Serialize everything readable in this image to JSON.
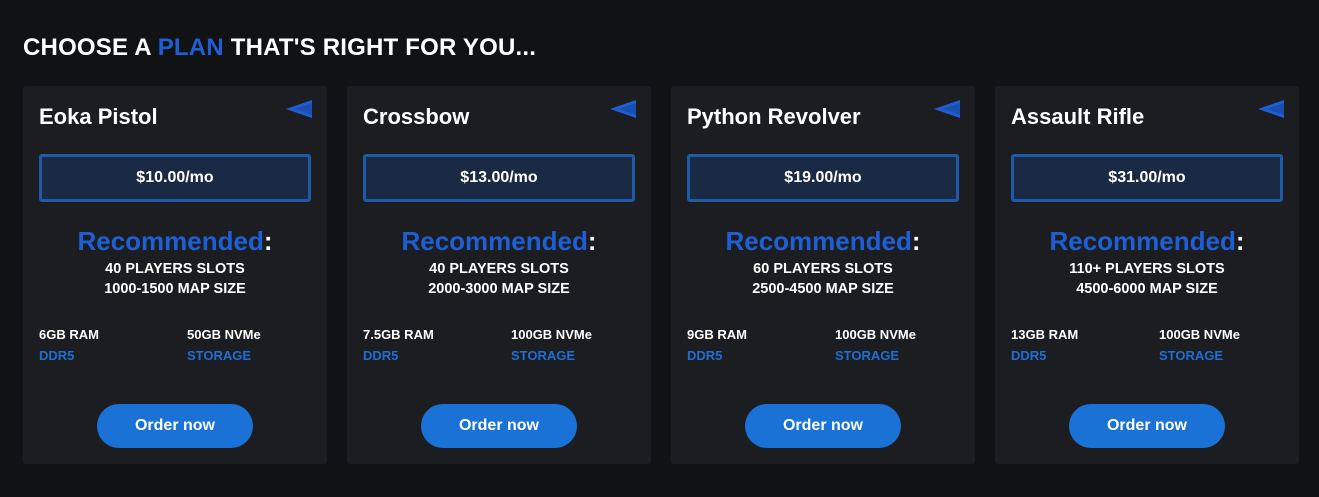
{
  "heading": {
    "prefix": "CHOOSE A ",
    "accent": "PLAN",
    "suffix": " THAT'S RIGHT FOR YOU..."
  },
  "colors": {
    "background": "#111214",
    "card": "#1c1d20",
    "accent": "#1f5fd6",
    "button": "#1a72d6",
    "price_border": "#1e5aa8",
    "price_fill": "#1a2a44"
  },
  "plans": [
    {
      "name": "Eoka Pistol",
      "icon": "arrow-left-icon",
      "price": "$10.00/mo",
      "recommended_label": "Recommended",
      "recommended_colon": ":",
      "players": "40 PLAYERS SLOTS",
      "map_size": "1000-1500 MAP SIZE",
      "ram": "6GB RAM",
      "ram_sub": "DDR5",
      "storage": "50GB NVMe",
      "storage_sub": "STORAGE",
      "button": "Order now"
    },
    {
      "name": "Crossbow",
      "icon": "arrow-left-icon",
      "price": "$13.00/mo",
      "recommended_label": "Recommended",
      "recommended_colon": ":",
      "players": "40 PLAYERS SLOTS",
      "map_size": "2000-3000 MAP SIZE",
      "ram": "7.5GB RAM",
      "ram_sub": "DDR5",
      "storage": "100GB NVMe",
      "storage_sub": "STORAGE",
      "button": "Order now"
    },
    {
      "name": "Python Revolver",
      "icon": "arrow-left-icon",
      "price": "$19.00/mo",
      "recommended_label": "Recommended",
      "recommended_colon": ":",
      "players": "60 PLAYERS SLOTS",
      "map_size": "2500-4500 MAP SIZE",
      "ram": "9GB RAM",
      "ram_sub": "DDR5",
      "storage": "100GB NVMe",
      "storage_sub": "STORAGE",
      "button": "Order now"
    },
    {
      "name": "Assault Rifle",
      "icon": "arrow-left-icon",
      "price": "$31.00/mo",
      "recommended_label": "Recommended",
      "recommended_colon": ":",
      "players": "110+ PLAYERS SLOTS",
      "map_size": "4500-6000 MAP SIZE",
      "ram": "13GB RAM",
      "ram_sub": "DDR5",
      "storage": "100GB NVMe",
      "storage_sub": "STORAGE",
      "button": "Order now"
    }
  ]
}
